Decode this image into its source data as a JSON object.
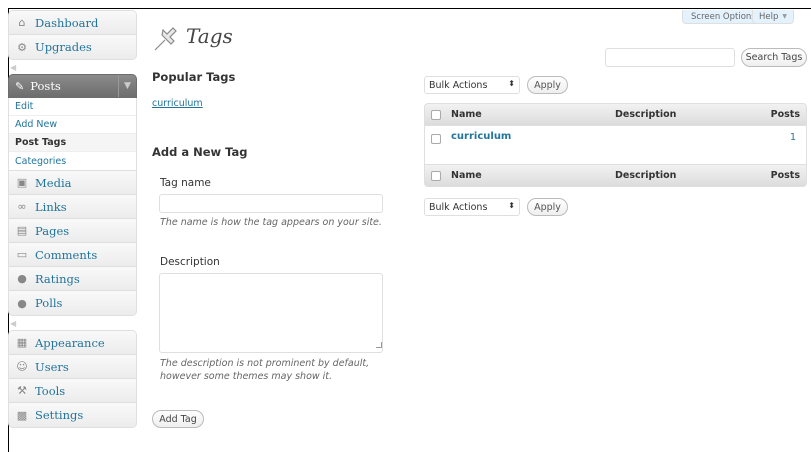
{
  "sidebar": {
    "group1": [
      {
        "label": "Dashboard",
        "icon": "house-icon"
      },
      {
        "label": "Upgrades",
        "icon": "upgrades-icon"
      }
    ],
    "posts": {
      "label": "Posts",
      "submenu": [
        {
          "label": "Edit"
        },
        {
          "label": "Add New"
        },
        {
          "label": "Post Tags",
          "current": true
        },
        {
          "label": "Categories"
        }
      ]
    },
    "group2": [
      {
        "label": "Media"
      },
      {
        "label": "Links"
      },
      {
        "label": "Pages"
      },
      {
        "label": "Comments"
      },
      {
        "label": "Ratings"
      },
      {
        "label": "Polls"
      }
    ],
    "group3": [
      {
        "label": "Appearance"
      },
      {
        "label": "Users"
      },
      {
        "label": "Tools"
      },
      {
        "label": "Settings"
      }
    ]
  },
  "header": {
    "screen_options": "Screen Options",
    "help": "Help",
    "title": "Tags"
  },
  "search": {
    "value": "",
    "button": "Search Tags"
  },
  "popular": {
    "heading": "Popular Tags",
    "tags": [
      "curriculum"
    ]
  },
  "add_form": {
    "heading": "Add a New Tag",
    "name_label": "Tag name",
    "name_value": "",
    "name_help": "The name is how the tag appears on your site.",
    "desc_label": "Description",
    "desc_value": "",
    "desc_help_line1": "The description is not prominent by default,",
    "desc_help_line2": "however some themes may show it.",
    "submit": "Add Tag"
  },
  "table": {
    "bulk_label": "Bulk Actions",
    "apply_label": "Apply",
    "columns": [
      "Name",
      "Description",
      "Posts"
    ],
    "rows": [
      {
        "name": "curriculum",
        "description": "",
        "posts": "1"
      }
    ]
  }
}
